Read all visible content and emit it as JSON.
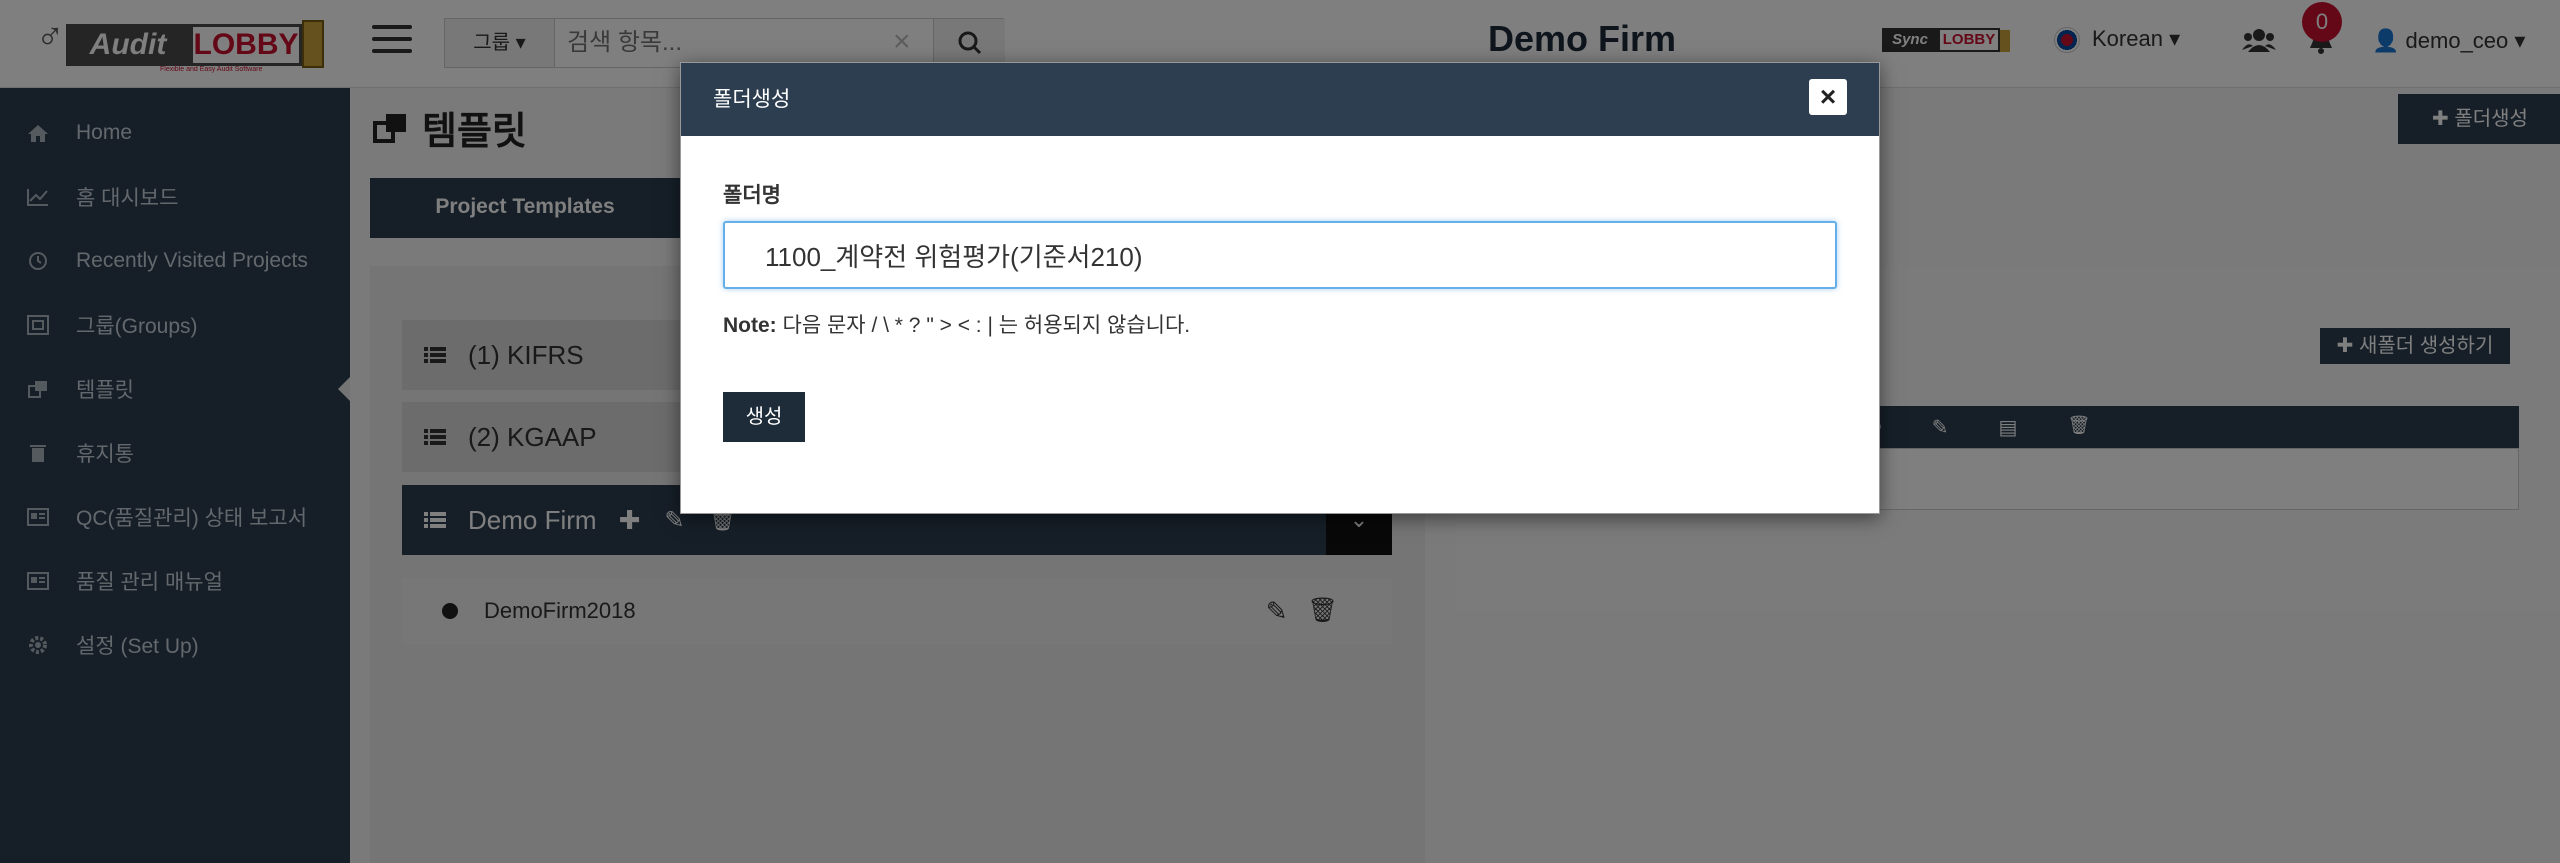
{
  "topbar": {
    "logo_audit": "Audit",
    "logo_lobby": "LOBBY",
    "logo_tag": "Flexible and Easy Audit Software",
    "search_group_label": "그룹",
    "search_placeholder": "검색 항목...",
    "firm_name": "Demo Firm",
    "sync_label_1": "Sync",
    "sync_label_2": "LOBBY",
    "language": "Korean",
    "notification_count": "0",
    "username": "demo_ceo"
  },
  "sidebar": {
    "items": [
      {
        "label": "Home",
        "icon": "home-icon"
      },
      {
        "label": "홈 대시보드",
        "icon": "line-chart-icon"
      },
      {
        "label": "Recently Visited Projects",
        "icon": "clock-icon"
      },
      {
        "label": "그룹(Groups)",
        "icon": "group-icon"
      },
      {
        "label": "템플릿",
        "icon": "clone-icon"
      },
      {
        "label": "휴지통",
        "icon": "trash-icon"
      },
      {
        "label": "QC(품질관리) 상태 보고서",
        "icon": "newspaper-icon"
      },
      {
        "label": "품질 관리 매뉴얼",
        "icon": "newspaper-icon"
      },
      {
        "label": "설정 (Set Up)",
        "icon": "gear-icon"
      }
    ],
    "active_index": 4
  },
  "main": {
    "page_title": "템플릿",
    "top_right_button": "폴더생성",
    "tab_label": "Project Templates",
    "tree": [
      {
        "label": "(1) KIFRS"
      },
      {
        "label": "(2) KGAAP"
      },
      {
        "label": "Demo Firm"
      }
    ],
    "sub_item": "DemoFirm2018",
    "right_button": "새폴더 생성하기"
  },
  "modal": {
    "title": "폴더생성",
    "close_label": "×",
    "field_label": "폴더명",
    "field_value": "1100_계약전 위험평가(기준서210)",
    "note_bold": "Note:",
    "note_text": " 다음 문자 / \\ * ? \" > < : | 는 허용되지 않습니다.",
    "create_button": "생성"
  },
  "colors": {
    "navy": "#2d3e50",
    "accent_red": "#c8102e",
    "focus_blue": "#66afe9"
  }
}
